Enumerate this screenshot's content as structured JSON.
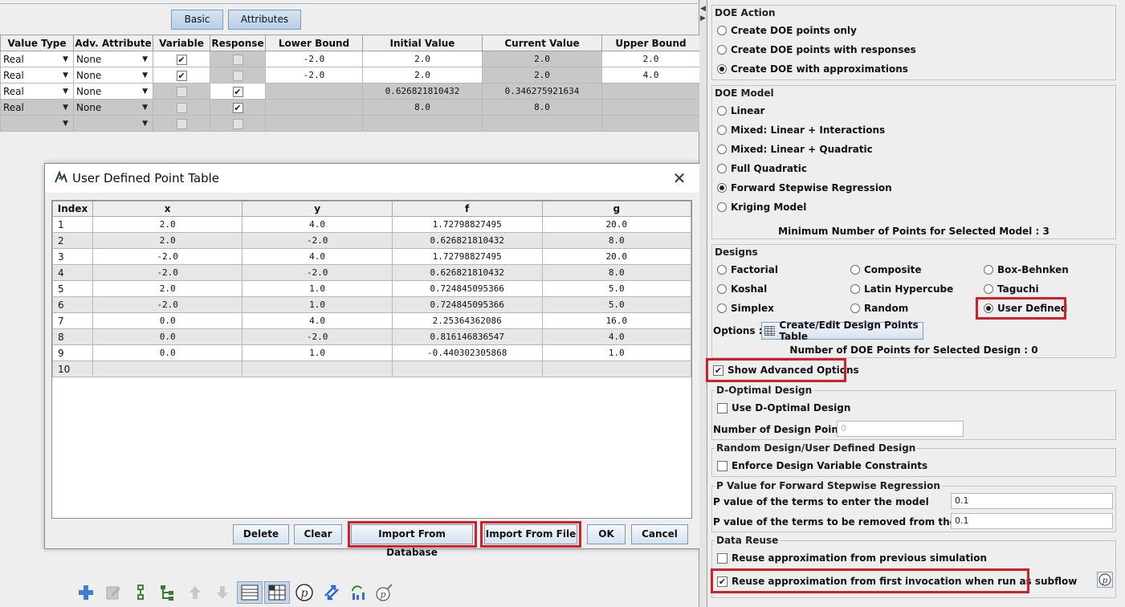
{
  "tabs": {
    "basic": "Basic",
    "attributes": "Attributes"
  },
  "variables_table": {
    "headers": [
      "Value Type",
      "Adv. Attribute",
      "Variable",
      "Response",
      "Lower Bound",
      "Initial Value",
      "Current Value",
      "Upper Bound"
    ],
    "rows": [
      {
        "type": "Real",
        "adv": "None",
        "variable": true,
        "response": false,
        "lower": "-2.0",
        "initial": "2.0",
        "current": "2.0",
        "upper": "2.0"
      },
      {
        "type": "Real",
        "adv": "None",
        "variable": true,
        "response": false,
        "lower": "-2.0",
        "initial": "2.0",
        "current": "2.0",
        "upper": "4.0"
      },
      {
        "type": "Real",
        "adv": "None",
        "variable": false,
        "response": true,
        "lower": "",
        "initial": "0.626821810432",
        "current": "0.346275921634",
        "upper": ""
      },
      {
        "type": "Real",
        "adv": "None",
        "variable": false,
        "response": true,
        "lower": "",
        "initial": "8.0",
        "current": "8.0",
        "upper": ""
      },
      {
        "type": "",
        "adv": "",
        "variable": false,
        "response": false,
        "lower": "",
        "initial": "",
        "current": "",
        "upper": ""
      }
    ]
  },
  "dialog": {
    "title": "User Defined Point Table",
    "headers": [
      "Index",
      "x",
      "y",
      "f",
      "g"
    ],
    "rows": [
      [
        "1",
        "2.0",
        "4.0",
        "1.72798827495",
        "20.0"
      ],
      [
        "2",
        "2.0",
        "-2.0",
        "0.626821810432",
        "8.0"
      ],
      [
        "3",
        "-2.0",
        "4.0",
        "1.72798827495",
        "20.0"
      ],
      [
        "4",
        "-2.0",
        "-2.0",
        "0.626821810432",
        "8.0"
      ],
      [
        "5",
        "2.0",
        "1.0",
        "0.724845095366",
        "5.0"
      ],
      [
        "6",
        "-2.0",
        "1.0",
        "0.724845095366",
        "5.0"
      ],
      [
        "7",
        "0.0",
        "4.0",
        "2.25364362086",
        "16.0"
      ],
      [
        "8",
        "0.0",
        "-2.0",
        "0.816146836547",
        "4.0"
      ],
      [
        "9",
        "0.0",
        "1.0",
        "-0.440302305868",
        "1.0"
      ],
      [
        "10",
        "",
        "",
        "",
        ""
      ]
    ],
    "buttons": {
      "delete": "Delete",
      "clear": "Clear",
      "import_db": "Import From Database",
      "import_file": "Import From File",
      "ok": "OK",
      "cancel": "Cancel"
    }
  },
  "right_panel": {
    "doe_action": {
      "title": "DOE Action",
      "options": [
        "Create DOE points only",
        "Create DOE points with responses",
        "Create DOE with approximations"
      ],
      "selected": 2
    },
    "doe_model": {
      "title": "DOE Model",
      "options": [
        "Linear",
        "Mixed: Linear + Interactions",
        "Mixed: Linear + Quadratic",
        "Full Quadratic",
        "Forward Stepwise Regression",
        "Kriging Model"
      ],
      "selected": 4,
      "min_points": "Minimum Number of Points for Selected Model : 3"
    },
    "designs": {
      "title": "Designs",
      "options": [
        "Factorial",
        "Composite",
        "Box-Behnken",
        "Koshal",
        "Latin Hypercube",
        "Taguchi",
        "Simplex",
        "Random",
        "User Defined"
      ],
      "selected": 8,
      "options_label": "Options :",
      "edit_button": "Create/Edit Design Points Table",
      "num_points": "Number of DOE Points for Selected Design : 0"
    },
    "show_advanced": {
      "label": "Show Advanced Options",
      "checked": true
    },
    "d_optimal": {
      "title": "D-Optimal Design",
      "use_label": "Use D-Optimal Design",
      "num_label": "Number of Design Points:",
      "num_value": "0"
    },
    "random_design": {
      "title": "Random Design/User Defined Design",
      "enforce_label": "Enforce Design Variable Constraints"
    },
    "p_value": {
      "title": "P Value for Forward Stepwise Regression",
      "enter_label": "P value of the terms to enter the model",
      "enter_value": "0.1",
      "remove_label": "P value of the terms to be removed from the model",
      "remove_value": "0.1"
    },
    "data_reuse": {
      "title": "Data Reuse",
      "reuse_prev": "Reuse approximation from previous simulation",
      "reuse_first": "Reuse approximation from first invocation when run as subflow",
      "reuse_first_checked": true
    }
  },
  "colors": {
    "highlight": "#d0202a",
    "button_border": "#7e9bbd",
    "greyed_cell": "#c8c8c8"
  }
}
